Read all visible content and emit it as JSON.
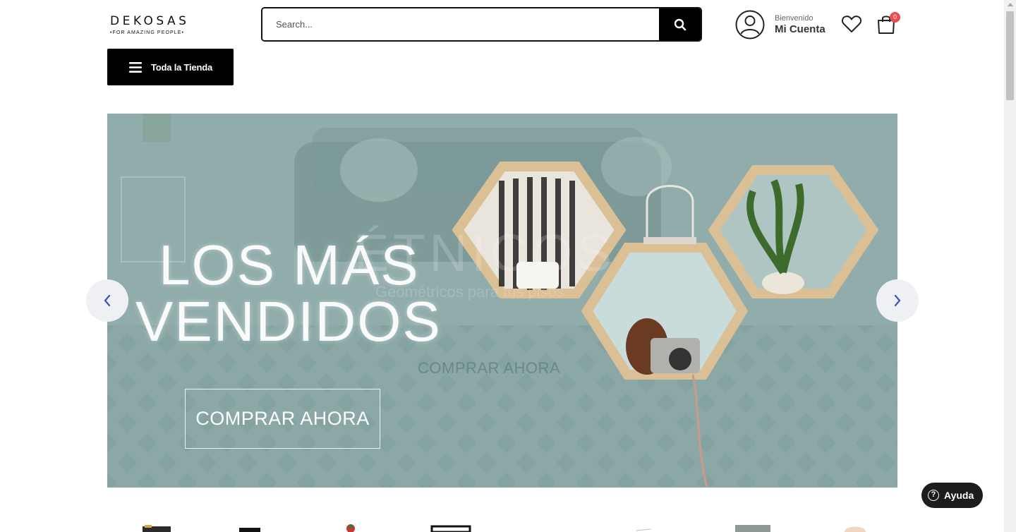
{
  "brand": {
    "name": "DEKOSAS",
    "tagline": "•FOR AMAZING PEOPLE•"
  },
  "search": {
    "placeholder": "Search...",
    "icon": "search-icon"
  },
  "account": {
    "welcome": "Bienvenido",
    "name": "Mi Cuenta",
    "icon": "user-circle-icon"
  },
  "wishlist": {
    "icon": "heart-icon"
  },
  "cart": {
    "icon": "shopping-bag-icon",
    "count": "0"
  },
  "menu": {
    "label": "Toda la Tienda",
    "icon": "hamburger-icon"
  },
  "banner": {
    "title_line1": "LOS MÁS",
    "title_line2": "VENDIDOS",
    "cta": "COMPRAR AHORA",
    "ghost_title": "ÉTNICOS",
    "ghost_subtitle": "Geométricos para tus pisos",
    "ghost_cta": "COMPRAR AHORA",
    "prev_icon": "chevron-left-icon",
    "next_icon": "chevron-right-icon"
  },
  "help": {
    "label": "Ayuda",
    "icon": "question-circle-icon"
  },
  "colors": {
    "accent": "#000000",
    "badge": "#e84d4d",
    "banner_bg": "#8fabaa",
    "arrow_icon": "#3a4fc7"
  }
}
